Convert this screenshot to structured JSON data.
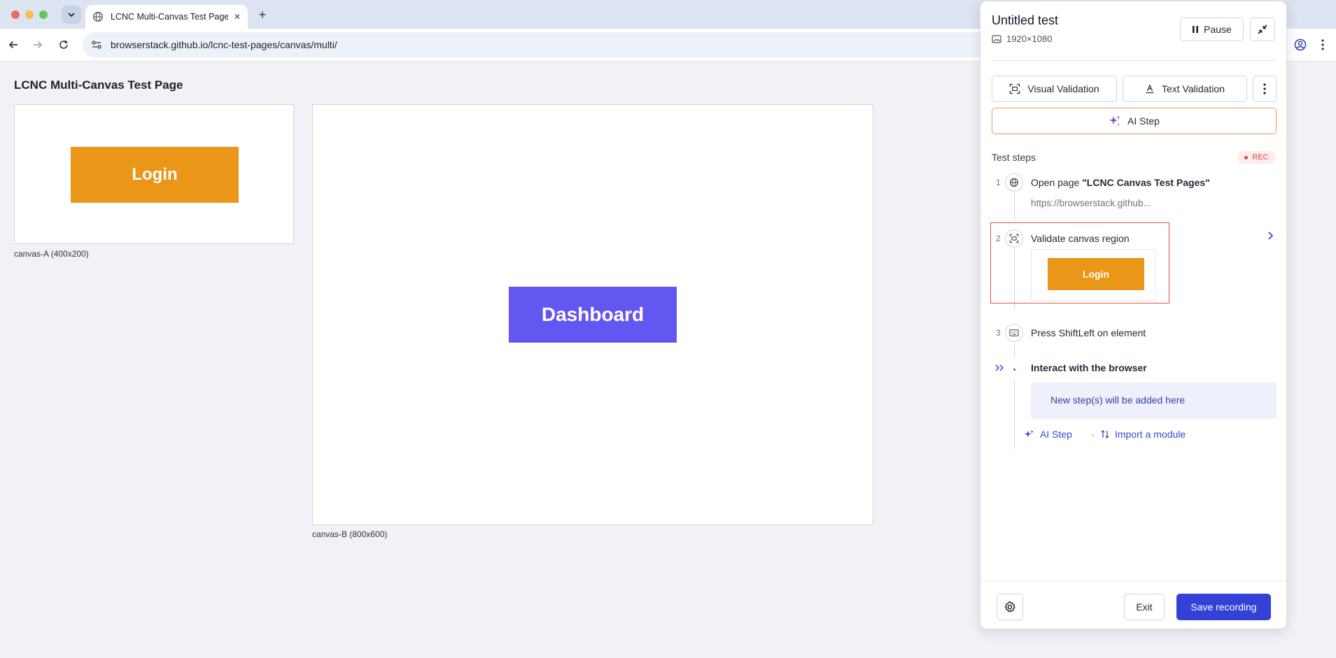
{
  "browser": {
    "tab_title": "LCNC Multi-Canvas Test Page",
    "tab_close": "✕",
    "new_tab": "+",
    "url": "browserstack.github.io/lcnc-test-pages/canvas/multi/"
  },
  "page": {
    "title": "LCNC Multi-Canvas Test Page",
    "canvas_a": {
      "button_label": "Login",
      "caption": "canvas-A (400x200)"
    },
    "canvas_b": {
      "button_label": "Dashboard",
      "caption": "canvas-B (800x600)"
    }
  },
  "panel": {
    "title": "Untitled test",
    "resolution": "1920×1080",
    "pause_label": "Pause",
    "visual_validation_label": "Visual Validation",
    "text_validation_label": "Text Validation",
    "ai_step_label": "AI Step",
    "test_steps_label": "Test steps",
    "rec_label": "REC",
    "steps": [
      {
        "number": "1",
        "prefix": "Open page ",
        "name": "\"LCNC Canvas Test Pages\"",
        "subtitle": "https://browserstack.github..."
      },
      {
        "number": "2",
        "text": "Validate canvas region",
        "thumbnail_label": "Login"
      },
      {
        "number": "3",
        "text": "Press ShiftLeft on element"
      }
    ],
    "interact_label": "Interact with the browser",
    "new_steps_text": "New step(s) will be added here",
    "link_ai_step": "AI Step",
    "link_import_module": "Import a module",
    "exit_label": "Exit",
    "save_label": "Save recording"
  },
  "colors": {
    "login_button": "#e99619",
    "dashboard_button": "#6456f0",
    "primary": "#3341d6",
    "rec": "#dc4b4b"
  },
  "icons": [
    "chevron-down-icon",
    "globe-icon",
    "plus-icon",
    "back-icon",
    "forward-icon",
    "reload-icon",
    "site-settings-icon",
    "profile-icon",
    "kebab-menu-icon",
    "image-icon",
    "pause-icon",
    "collapse-icon",
    "frame-icon",
    "text-icon",
    "sparkle-icon",
    "keyboard-icon",
    "chevron-right-icon",
    "double-chevron-icon",
    "import-icon",
    "gear-icon"
  ]
}
